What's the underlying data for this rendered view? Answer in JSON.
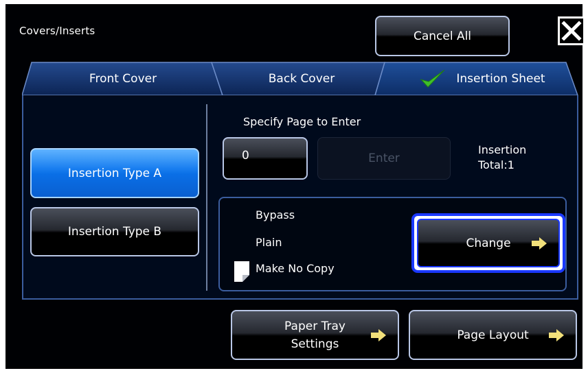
{
  "header": {
    "title": "Covers/Inserts",
    "cancel_all": "Cancel All",
    "close_icon": "close-x-icon"
  },
  "tabs": [
    {
      "label": "Front Cover",
      "selected": false
    },
    {
      "label": "Back Cover",
      "selected": false
    },
    {
      "label": "Insertion Sheet",
      "selected": true,
      "icon": "checkmark-icon"
    }
  ],
  "insertion_types": [
    {
      "label": "Insertion Type A",
      "selected": true
    },
    {
      "label": "Insertion Type B",
      "selected": false
    }
  ],
  "page_entry": {
    "label": "Specify Page to Enter",
    "value": "0",
    "enter_label": "Enter"
  },
  "insertion_total": {
    "line1": "Insertion",
    "line2": "Total:1"
  },
  "paper": {
    "source": "Bypass",
    "type": "Plain",
    "copy": "Make No Copy",
    "change_label": "Change"
  },
  "footer": {
    "paper_tray_line1": "Paper Tray",
    "paper_tray_line2": "Settings",
    "page_layout": "Page Layout"
  },
  "colors": {
    "accent_blue": "#1a7ff0",
    "focus_border": "#1a38ff",
    "arrow_yellow": "#f2e07a",
    "check_green": "#3fbf2a"
  }
}
